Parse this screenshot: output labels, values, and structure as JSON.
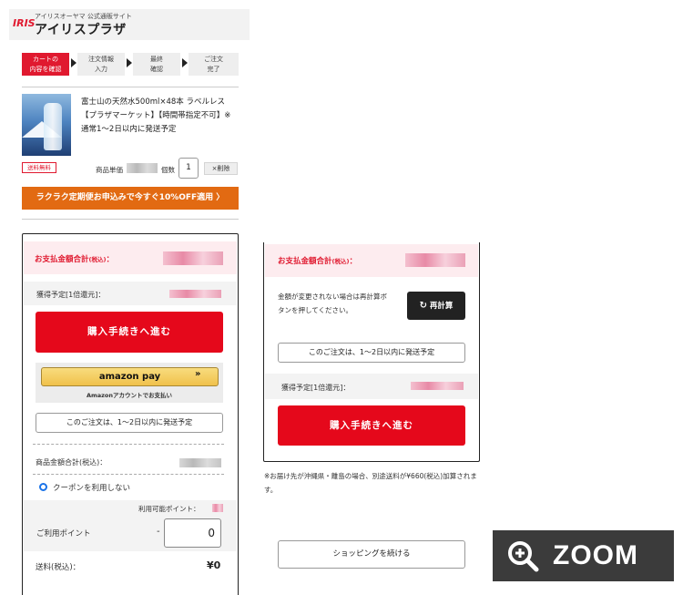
{
  "header": {
    "logo_mark": "IRIS",
    "logo_sub": "アイリスオーヤマ 公式通販サイト",
    "logo_main": "アイリスプラザ"
  },
  "steps": [
    {
      "line1": "カートの",
      "line2": "内容を確認",
      "active": true
    },
    {
      "line1": "注文情報",
      "line2": "入力",
      "active": false
    },
    {
      "line1": "最終",
      "line2": "確認",
      "active": false
    },
    {
      "line1": "ご注文",
      "line2": "完了",
      "active": false
    }
  ],
  "product": {
    "title": "富士山の天然水500ml×48本 ラベルレス【プラザマーケット】【時間帯指定不可】※通常1～2日以内に発送予定",
    "free_shipping": "送料無料",
    "unit_price_label": "商品単価",
    "qty_label": "個数",
    "qty_value": "1",
    "delete_label": "×削除"
  },
  "banner": {
    "text": "ラクラク定期便お申込みで今すぐ10%OFF適用 〉"
  },
  "left_summary": {
    "payment_total_label": "お支払金額合計",
    "tax_included": "(税込)",
    "colon": "：",
    "points_earned_label": "獲得予定[1倍還元]：",
    "checkout_button": "購入手続きへ進む",
    "amazon_pay_label": "amazon pay",
    "amazon_pay_arrow": "»",
    "amazon_note": "Amazonアカウントでお支払い",
    "ship_note_button": "このご注文は、1～2日以内に発送予定",
    "product_total_label": "商品金額合計(税込)：",
    "coupon_option": "クーポンを利用しない",
    "available_points_label": "利用可能ポイント：",
    "use_points_label": "ご利用ポイント",
    "points_minus": "-",
    "points_value": "0",
    "shipping_label": "送料(税込)：",
    "shipping_value": "¥0"
  },
  "right_summary": {
    "payment_total_label": "お支払金額合計",
    "tax_included": "(税込)",
    "colon": "：",
    "recalc_note": "金額が変更されない場合は再計算ボタンを押してください。",
    "recalc_button": "再計算",
    "ship_note_button": "このご注文は、1～2日以内に発送予定",
    "points_earned_label": "獲得予定[1倍還元]：",
    "checkout_button": "購入手続きへ進む"
  },
  "footnote": "※お届け先が沖縄県・離島の場合、別途送料が¥660(税込)加算されます。",
  "continue_button": "ショッピングを続ける",
  "zoom_label": "ZOOM",
  "colors": {
    "brand_red": "#e0192f",
    "banner_orange": "#e26a12",
    "amazon_yellow": "#f0c14b",
    "zoom_bg": "#3b3b3b"
  }
}
